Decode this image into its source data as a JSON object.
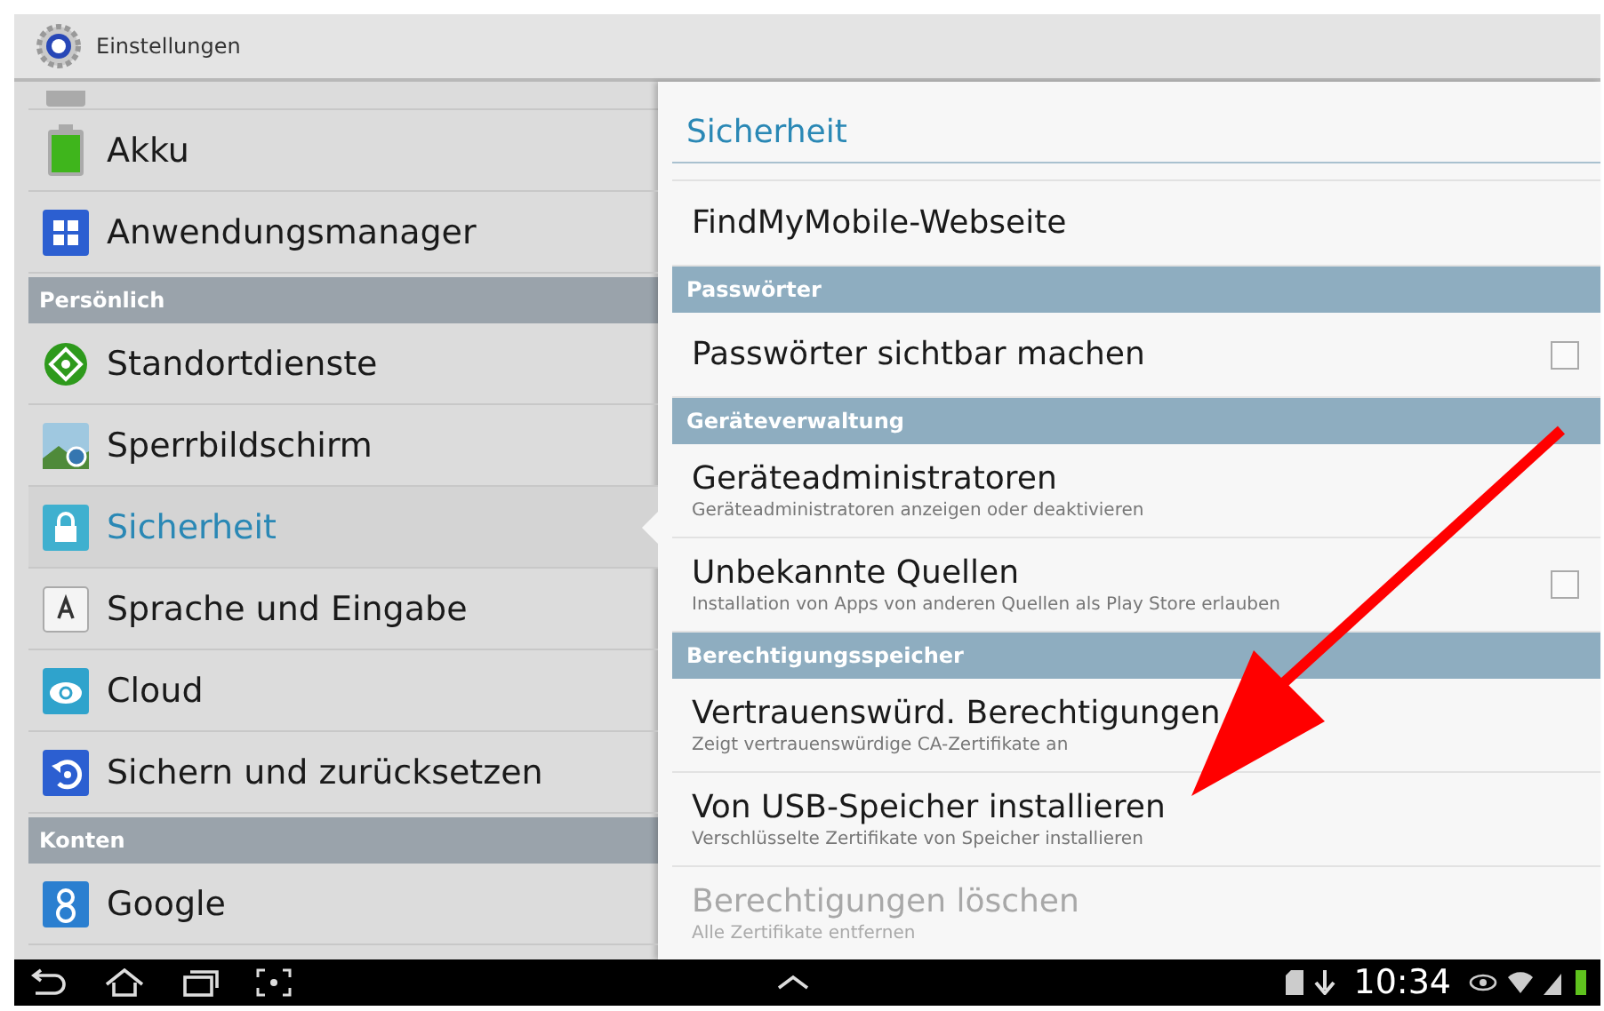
{
  "window": {
    "title": "Einstellungen"
  },
  "sidebar": {
    "items": [
      {
        "kind": "partial"
      },
      {
        "kind": "item",
        "label": "Akku",
        "selected": false
      },
      {
        "kind": "item",
        "label": "Anwendungsmanager",
        "selected": false
      },
      {
        "kind": "header",
        "label": "Persönlich"
      },
      {
        "kind": "item",
        "label": "Standortdienste",
        "selected": false
      },
      {
        "kind": "item",
        "label": "Sperrbildschirm",
        "selected": false
      },
      {
        "kind": "item",
        "label": "Sicherheit",
        "selected": true
      },
      {
        "kind": "item",
        "label": "Sprache und Eingabe",
        "selected": false
      },
      {
        "kind": "item",
        "label": "Cloud",
        "selected": false
      },
      {
        "kind": "item",
        "label": "Sichern und zurücksetzen",
        "selected": false
      },
      {
        "kind": "header",
        "label": "Konten"
      },
      {
        "kind": "item",
        "label": "Google",
        "selected": false
      }
    ]
  },
  "detail": {
    "title": "Sicherheit",
    "items": [
      {
        "kind": "partial"
      },
      {
        "kind": "item",
        "title": "FindMyMobile-Webseite",
        "disabled": false
      },
      {
        "kind": "header",
        "title": "Passwörter"
      },
      {
        "kind": "checkbox",
        "title": "Passwörter sichtbar machen",
        "checked": false,
        "disabled": false
      },
      {
        "kind": "header",
        "title": "Geräteverwaltung"
      },
      {
        "kind": "item",
        "title": "Geräteadministratoren",
        "subtitle": "Geräteadministratoren anzeigen oder deaktivieren",
        "disabled": false
      },
      {
        "kind": "checkbox",
        "title": "Unbekannte Quellen",
        "subtitle": "Installation von Apps von anderen Quellen als Play Store erlauben",
        "checked": false,
        "disabled": false
      },
      {
        "kind": "header",
        "title": "Berechtigungsspeicher"
      },
      {
        "kind": "item",
        "title": "Vertrauenswürd. Berechtigungen",
        "subtitle": "Zeigt vertrauenswürdige CA-Zertifikate an",
        "disabled": false
      },
      {
        "kind": "item",
        "title": "Von USB-Speicher installieren",
        "subtitle": "Verschlüsselte Zertifikate von Speicher installieren",
        "disabled": false
      },
      {
        "kind": "item",
        "title": "Berechtigungen löschen",
        "subtitle": "Alle Zertifikate entfernen",
        "disabled": true
      }
    ]
  },
  "status_bar": {
    "time": "10:34"
  }
}
